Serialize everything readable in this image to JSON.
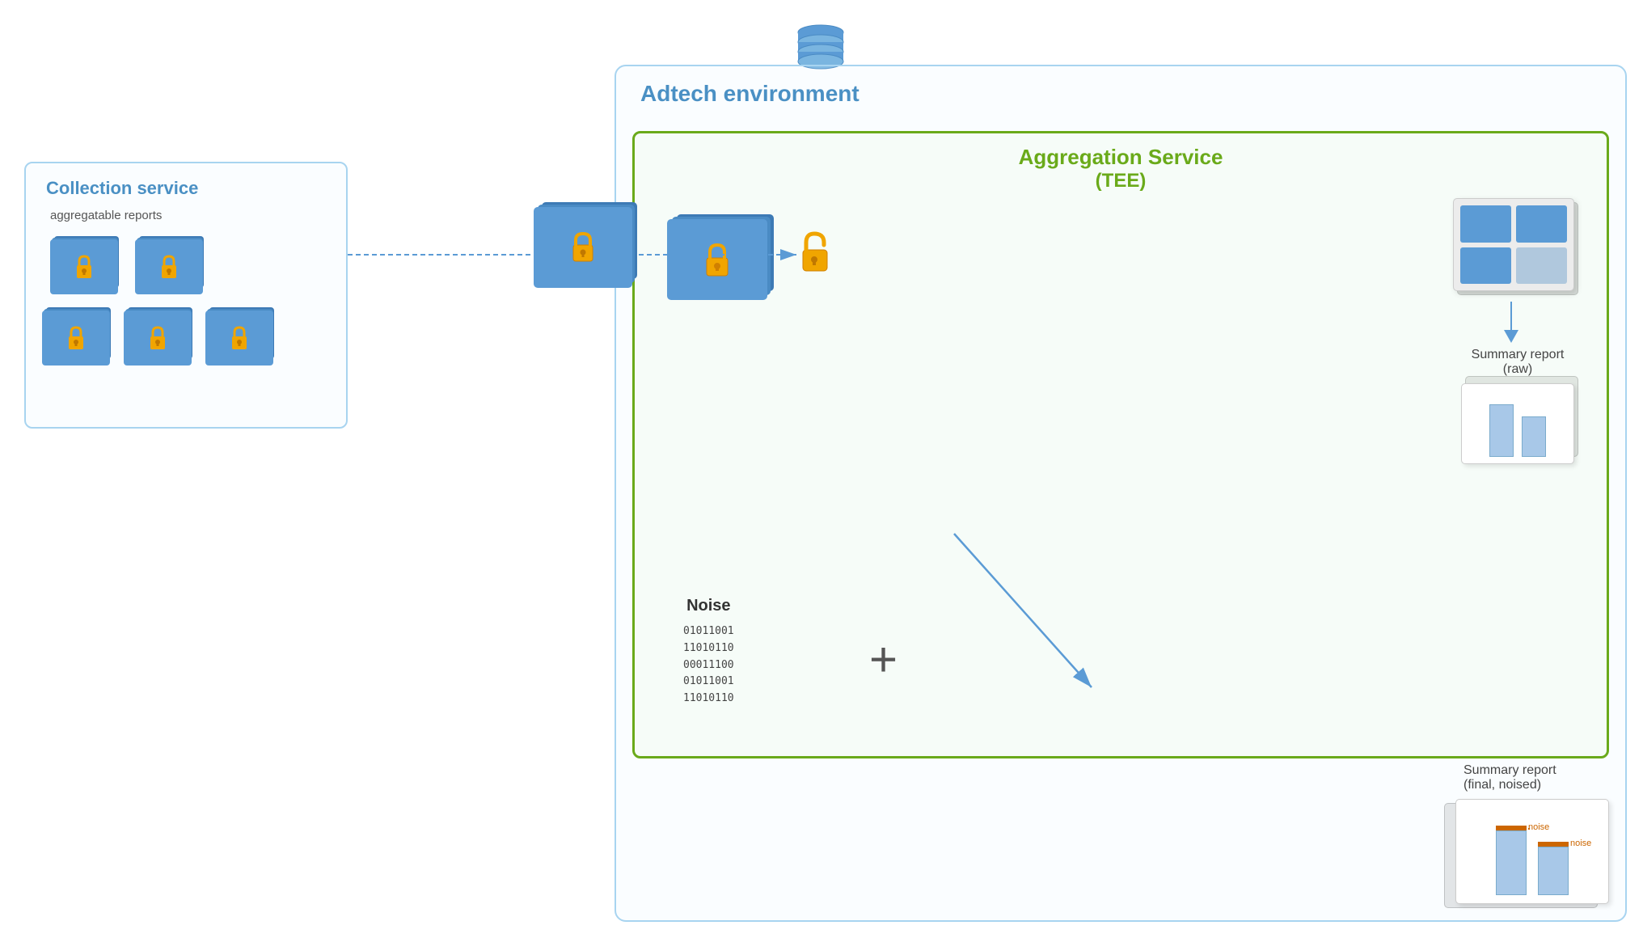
{
  "adtech": {
    "title": "Adtech environment"
  },
  "collection": {
    "title": "Collection service",
    "subtitle": "aggregatable reports"
  },
  "aggregation": {
    "title": "Aggregation Service",
    "title_sub": "(TEE)"
  },
  "noise": {
    "label": "Noise",
    "binary": [
      "01011001",
      "11010110",
      "00011100",
      "01011001",
      "11010110"
    ]
  },
  "summary_raw": {
    "label": "Summary report",
    "sublabel": "(raw)"
  },
  "summary_final": {
    "label": "Summary report",
    "sublabel": "(final, noised)"
  },
  "noise_annotation1": "noise",
  "noise_annotation2": "noise",
  "database_icon": "database"
}
